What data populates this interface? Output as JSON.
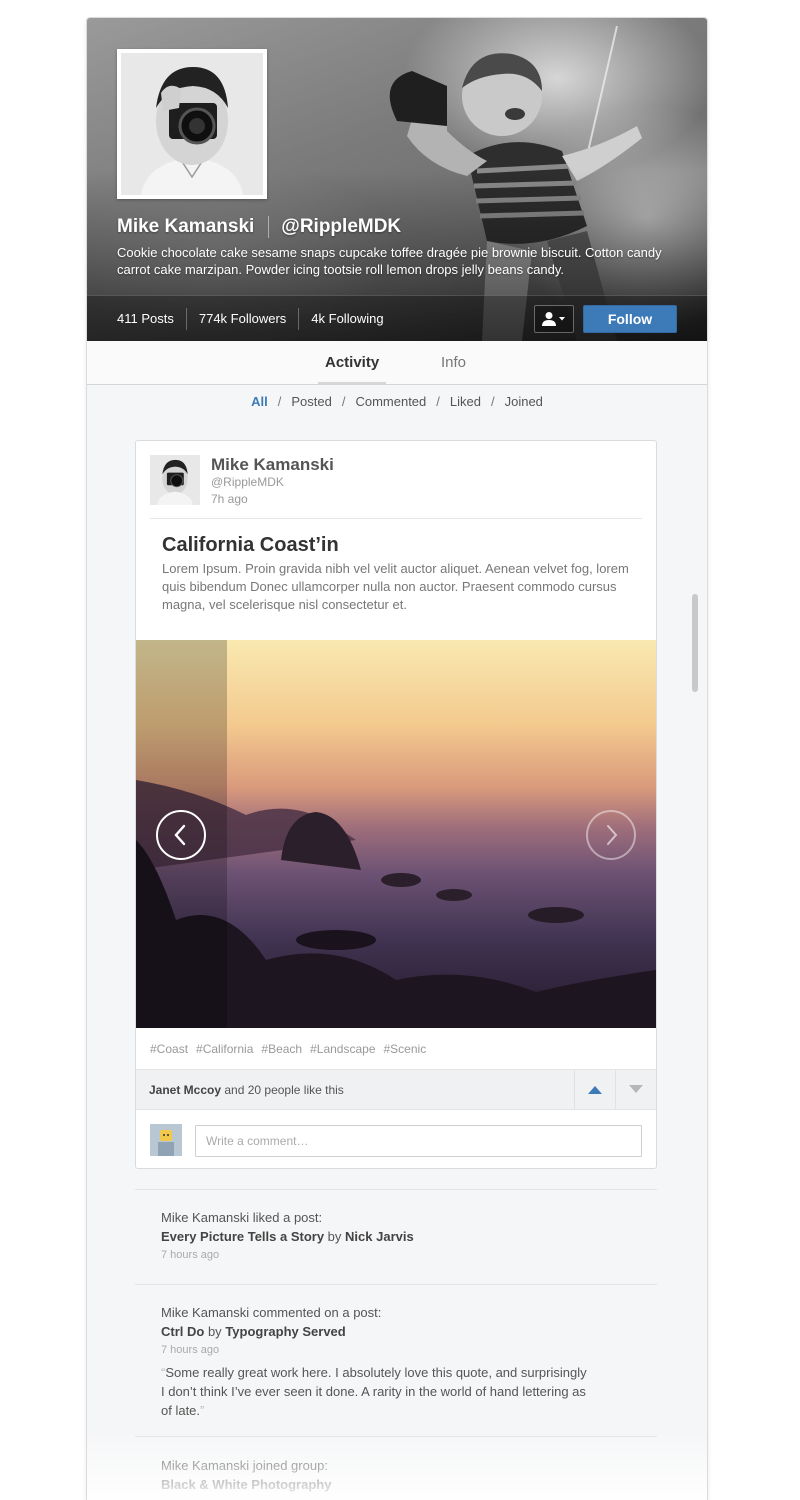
{
  "profile": {
    "name": "Mike Kamanski",
    "handle": "@RippleMDK",
    "bio": "Cookie chocolate cake sesame snaps cupcake toffee dragée pie brownie biscuit. Cotton candy carrot cake marzipan. Powder icing tootsie roll lemon drops jelly beans candy.",
    "stats": {
      "posts": "411 Posts",
      "followers": "774k Followers",
      "following": "4k Following"
    },
    "follow_label": "Follow"
  },
  "tabs": [
    {
      "label": "Activity",
      "active": true
    },
    {
      "label": "Info",
      "active": false
    }
  ],
  "filters": [
    {
      "label": "All",
      "active": true
    },
    {
      "label": "Posted",
      "active": false
    },
    {
      "label": "Commented",
      "active": false
    },
    {
      "label": "Liked",
      "active": false
    },
    {
      "label": "Joined",
      "active": false
    }
  ],
  "post": {
    "author": "Mike Kamanski",
    "handle": "@RippleMDK",
    "time": "7h ago",
    "title": "California Coast’in",
    "body": "Lorem Ipsum. Proin gravida nibh vel velit auctor aliquet. Aenean velvet fog, lorem quis bibendum Donec ullamcorper nulla non auctor. Praesent commodo cursus magna, vel scelerisque nisl consectetur et.",
    "tags": [
      "#Coast",
      "#California",
      "#Beach",
      "#Landscape",
      "#Scenic"
    ],
    "likes": {
      "name": "Janet Mccoy",
      "suffix": " and 20 people like this"
    },
    "comment_placeholder": "Write a comment…"
  },
  "activity": [
    {
      "action": "Mike Kamanski liked a post:",
      "title": "Every Picture Tells a Story",
      "by": " by ",
      "author": "Nick Jarvis",
      "time": "7 hours ago"
    },
    {
      "action": "Mike Kamanski commented on a post:",
      "title": "Ctrl Do",
      "by": " by ",
      "author": "Typography Served",
      "time": "7 hours ago",
      "quote": "Some really great work here. I absolutely love this quote, and surprisingly I don’t think I’ve ever seen it done. A rarity in the world of hand lettering as of late."
    },
    {
      "action": "Mike Kamanski joined group:",
      "title": "Black & White Photography"
    }
  ],
  "colors": {
    "accent": "#3d7ab8",
    "background": "#f5f6f7"
  },
  "icons": {
    "user_menu": "user-icon",
    "prev": "chevron-left-icon",
    "next": "chevron-right-icon",
    "upvote": "triangle-up-icon",
    "downvote": "triangle-down-icon"
  }
}
